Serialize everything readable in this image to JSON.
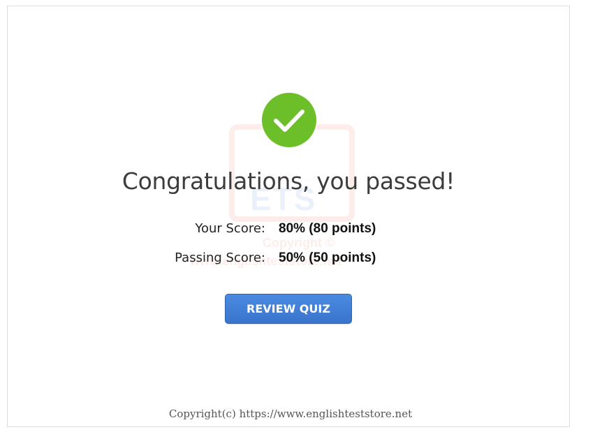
{
  "result": {
    "title": "Congratulations, you passed!",
    "status_color": "#6cbf28",
    "status_icon": "checkmark-icon"
  },
  "scores": {
    "your_score_label": "Your Score:",
    "your_score_value": "80% (80 points)",
    "passing_score_label": "Passing Score:",
    "passing_score_value": "50% (50 points)"
  },
  "actions": {
    "review_label": "REVIEW QUIZ",
    "button_color": "#3f7fd6"
  },
  "watermark": {
    "logo_text": "ETS",
    "copy_text": "Copyright ©",
    "url_text": "www.englishteststore.net"
  },
  "footer": {
    "copyright": "Copyright(c) https://www.englishteststore.net"
  }
}
